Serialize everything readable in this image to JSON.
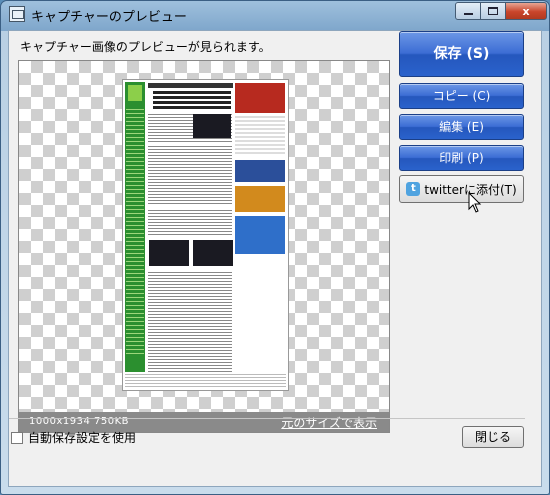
{
  "window": {
    "title": "キャプチャーのプレビュー",
    "minimize_glyph": "",
    "close_glyph": "x"
  },
  "main": {
    "description": "キャプチャー画像のプレビューが見られます。",
    "image_info": "1000x1934  750KB",
    "original_size_link": "元のサイズで表示"
  },
  "actions": {
    "save_label": "保存 (S)",
    "copy_label": "コピー (C)",
    "edit_label": "編集 (E)",
    "print_label": "印刷 (P)",
    "twitter_label": "twitterに添付(T)",
    "twitter_icon_glyph": "t"
  },
  "footer": {
    "auto_save_label": "自動保存設定を使用",
    "auto_save_checked": false,
    "close_label": "閉じる"
  },
  "icons": [
    "window-app-icon",
    "minimize-icon",
    "maximize-icon",
    "close-icon",
    "twitter-icon",
    "mouse-cursor-icon"
  ]
}
